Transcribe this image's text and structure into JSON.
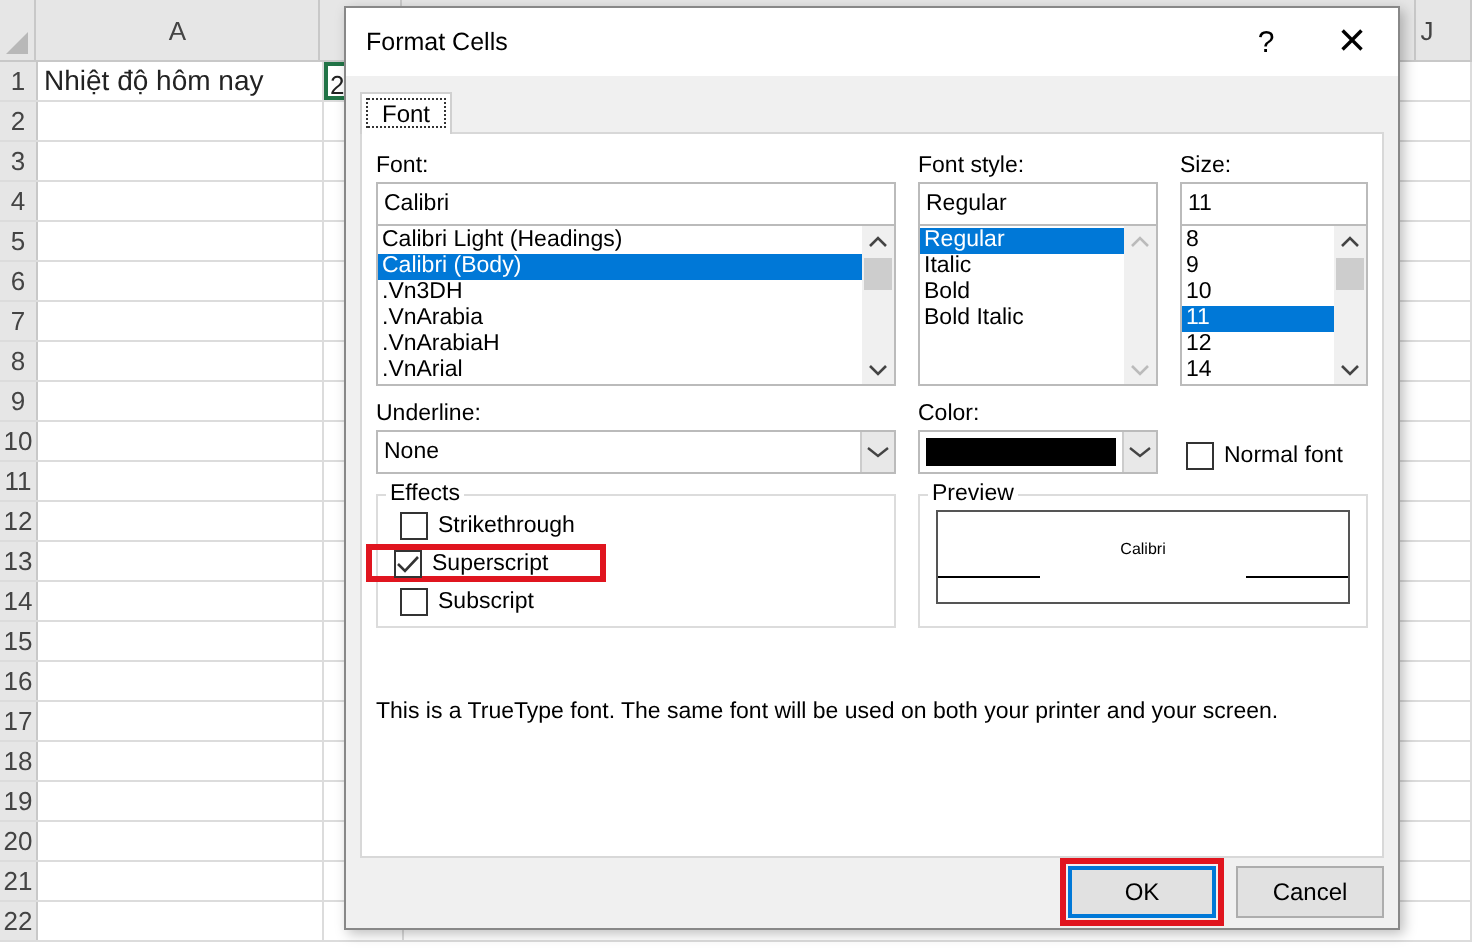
{
  "sheet": {
    "columns": [
      {
        "label": "A"
      },
      {
        "label": "J"
      }
    ],
    "rows": [
      "1",
      "2",
      "3",
      "4",
      "5",
      "6",
      "7",
      "8",
      "9",
      "10",
      "11",
      "12",
      "13",
      "14",
      "15",
      "16",
      "17",
      "18",
      "19",
      "20",
      "21",
      "22"
    ],
    "cells": [
      {
        "text": "Nhiệt độ hôm nay"
      },
      {
        "text": "2"
      }
    ]
  },
  "dialog": {
    "title": "Format Cells",
    "help": "?",
    "close": "×",
    "tabs": [
      {
        "label": "Font",
        "selected": true
      }
    ],
    "font": {
      "label": "Font:",
      "value": "Calibri",
      "items": [
        {
          "label": "Calibri Light (Headings)",
          "selected": false
        },
        {
          "label": "Calibri (Body)",
          "selected": true
        },
        {
          "label": ".Vn3DH",
          "selected": false
        },
        {
          "label": ".VnArabia",
          "selected": false
        },
        {
          "label": ".VnArabiaH",
          "selected": false
        },
        {
          "label": ".VnArial",
          "selected": false
        }
      ]
    },
    "font_style": {
      "label": "Font style:",
      "value": "Regular",
      "items": [
        {
          "label": "Regular",
          "selected": true
        },
        {
          "label": "Italic",
          "selected": false
        },
        {
          "label": "Bold",
          "selected": false
        },
        {
          "label": "Bold Italic",
          "selected": false
        }
      ]
    },
    "size": {
      "label": "Size:",
      "value": "11",
      "items": [
        {
          "label": "8",
          "selected": false
        },
        {
          "label": "9",
          "selected": false
        },
        {
          "label": "10",
          "selected": false
        },
        {
          "label": "11",
          "selected": true
        },
        {
          "label": "12",
          "selected": false
        },
        {
          "label": "14",
          "selected": false
        }
      ]
    },
    "underline": {
      "label": "Underline:",
      "value": "None"
    },
    "color": {
      "label": "Color:",
      "color": "#000000"
    },
    "normal_font": {
      "label": "Normal font",
      "checked": false
    },
    "effects": {
      "title": "Effects",
      "items": [
        {
          "label": "Strikethrough",
          "checked": false,
          "highlighted": false
        },
        {
          "label": "Superscript",
          "checked": true,
          "highlighted": true
        },
        {
          "label": "Subscript",
          "checked": false,
          "highlighted": false
        }
      ]
    },
    "preview": {
      "title": "Preview",
      "sample": "Calibri"
    },
    "note": "This is a TrueType font.  The same font will be used on both your printer and your screen.",
    "buttons": [
      {
        "label": "OK",
        "highlighted": true
      },
      {
        "label": "Cancel",
        "highlighted": false
      }
    ]
  }
}
